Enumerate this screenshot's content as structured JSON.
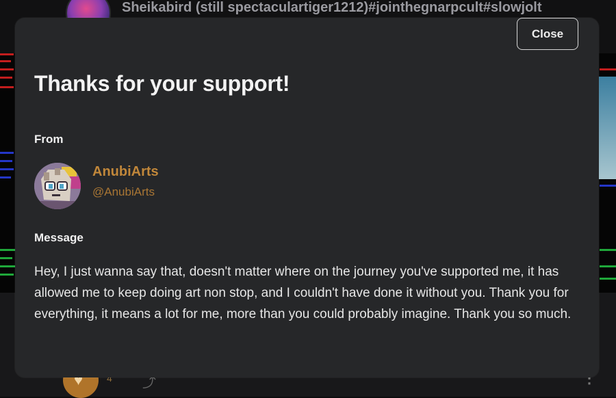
{
  "background": {
    "post_title": "Sheikabird (still spectaculartiger1212)#jointhegnarpcult#slowjolt",
    "like_count": "4",
    "icons": {
      "like": "heart-icon",
      "share": "share-icon",
      "more": "more-options-icon"
    }
  },
  "modal": {
    "close_label": "Close",
    "title": "Thanks for your support!",
    "from_label": "From",
    "supporter": {
      "display_name": "AnubiArts",
      "handle": "@AnubiArts"
    },
    "message_label": "Message",
    "message": "Hey, I just wanna say that, doesn't matter where on the journey you've supported me, it has allowed me to keep doing art non stop, and I couldn't have done it without you. Thank you for everything, it means a lot for me, more than you could probably imagine. Thank you so much."
  },
  "colors": {
    "modal_bg": "#262729",
    "accent_name": "#c1873a",
    "text": "#e6e6e6"
  }
}
